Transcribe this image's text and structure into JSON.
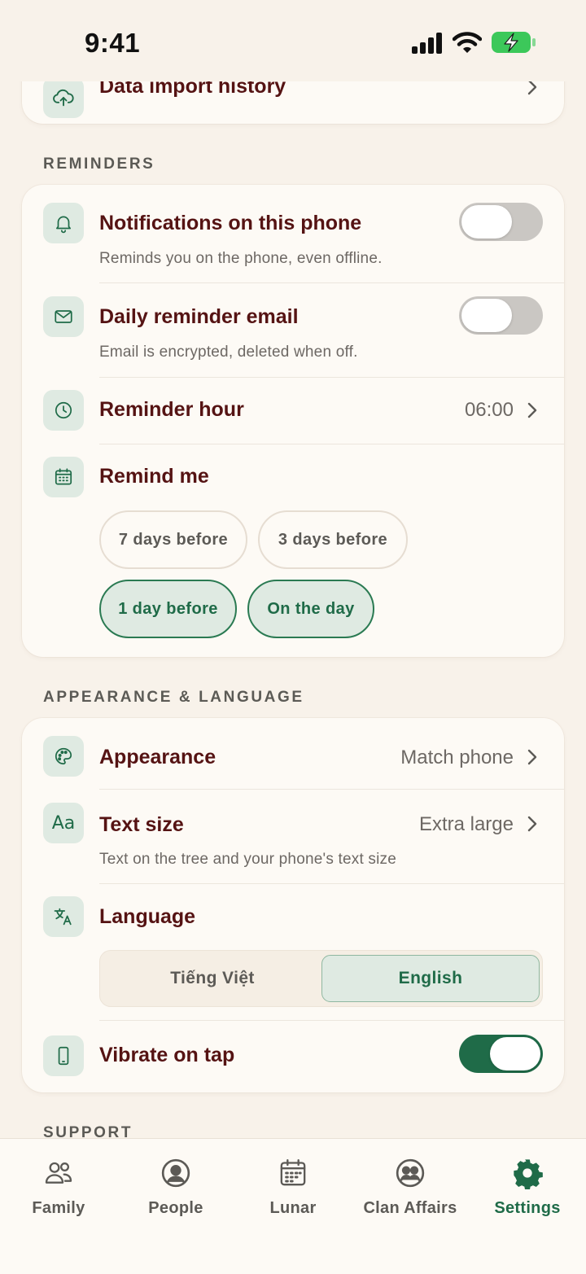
{
  "status_bar": {
    "time": "9:41"
  },
  "top_card": {
    "title": "Data import history"
  },
  "reminders": {
    "section_title": "REMINDERS",
    "notifications": {
      "title": "Notifications on this phone",
      "subtitle": "Reminds you on the phone, even offline.",
      "enabled": false
    },
    "email": {
      "title": "Daily reminder email",
      "subtitle": "Email is encrypted, deleted when off.",
      "enabled": false
    },
    "hour": {
      "title": "Reminder hour",
      "value": "06:00"
    },
    "remind_me": {
      "title": "Remind me",
      "options": [
        {
          "label": "7 days before",
          "selected": false
        },
        {
          "label": "3 days before",
          "selected": false
        },
        {
          "label": "1 day before",
          "selected": true
        },
        {
          "label": "On the day",
          "selected": true
        }
      ]
    }
  },
  "appearance_language": {
    "section_title": "APPEARANCE & LANGUAGE",
    "appearance": {
      "title": "Appearance",
      "value": "Match phone"
    },
    "text_size": {
      "title": "Text size",
      "value": "Extra large",
      "subtitle": "Text on the tree and your phone's text size"
    },
    "language": {
      "title": "Language",
      "options": [
        "Tiếng Việt",
        "English"
      ],
      "selected": "English"
    },
    "vibrate": {
      "title": "Vibrate on tap",
      "enabled": true
    }
  },
  "support": {
    "section_title": "SUPPORT"
  },
  "tab_bar": {
    "tabs": [
      {
        "label": "Family",
        "icon": "family-icon",
        "active": false
      },
      {
        "label": "People",
        "icon": "person-icon",
        "active": false
      },
      {
        "label": "Lunar",
        "icon": "calendar-icon",
        "active": false
      },
      {
        "label": "Clan Affairs",
        "icon": "clan-icon",
        "active": false
      },
      {
        "label": "Settings",
        "icon": "gear-icon",
        "active": true
      }
    ]
  },
  "colors": {
    "accent": "#1f6b48",
    "title": "#551313",
    "background": "#f8f2ea",
    "tile": "#dfeae2"
  }
}
